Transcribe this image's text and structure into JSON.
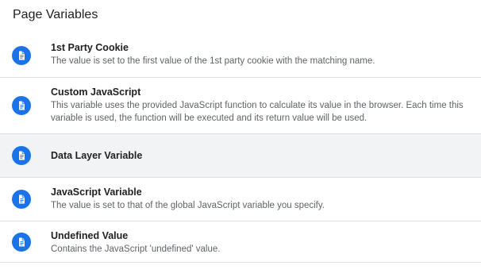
{
  "section": {
    "title": "Page Variables"
  },
  "colors": {
    "accent": "#1a73e8",
    "selected_row": "#f1f3f4",
    "divider": "#e0e0e0"
  },
  "items": [
    {
      "name": "1st Party Cookie",
      "description": "The value is set to the first value of the 1st party cookie with the matching name.",
      "icon": "document-icon"
    },
    {
      "name": "Custom JavaScript",
      "description": "This variable uses the provided JavaScript function to calculate its value in the browser. Each time this variable is used, the function will be executed and its return value will be used.",
      "icon": "document-icon"
    },
    {
      "name": "Data Layer Variable",
      "description": "",
      "icon": "document-icon",
      "selected": true
    },
    {
      "name": "JavaScript Variable",
      "description": "The value is set to that of the global JavaScript variable you specify.",
      "icon": "document-icon"
    },
    {
      "name": "Undefined Value",
      "description": "Contains the JavaScript 'undefined' value.",
      "icon": "document-icon"
    }
  ]
}
